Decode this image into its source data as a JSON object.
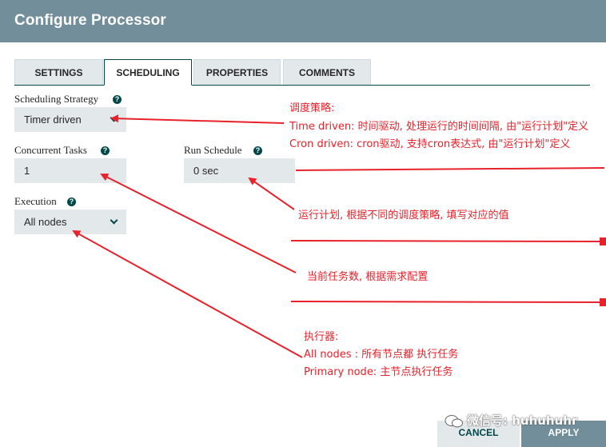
{
  "dialog": {
    "title": "Configure Processor"
  },
  "tabs": [
    {
      "label": "SETTINGS"
    },
    {
      "label": "SCHEDULING"
    },
    {
      "label": "PROPERTIES"
    },
    {
      "label": "COMMENTS"
    }
  ],
  "form": {
    "scheduling_strategy": {
      "label": "Scheduling Strategy",
      "value": "Timer driven"
    },
    "concurrent_tasks": {
      "label": "Concurrent Tasks",
      "value": "1"
    },
    "run_schedule": {
      "label": "Run Schedule",
      "value": "0 sec"
    },
    "execution": {
      "label": "Execution",
      "value": "All nodes"
    },
    "help_glyph": "?"
  },
  "annotations": {
    "strategy": [
      "调度策略:",
      "Time driven: 时间驱动, 处理运行的时间间隔, 由\"运行计划\"定义",
      "Cron driven: cron驱动, 支持cron表达式, 由\"运行计划\"定义"
    ],
    "run_schedule": "运行计划, 根据不同的调度策略, 填写对应的值",
    "concurrent_tasks": "当前任务数, 根据需求配置",
    "execution": [
      "执行器:",
      "All nodes : 所有节点都 执行任务",
      "Primary node:  主节点执行任务"
    ]
  },
  "footer": {
    "cancel_label": "CANCEL",
    "apply_label": "APPLY"
  },
  "watermark": "微信号: huhuhuhr",
  "colors": {
    "header": "#728e9b",
    "accent": "#004849",
    "field_bg": "#e3e8eb",
    "annotation": "#e8222b"
  }
}
